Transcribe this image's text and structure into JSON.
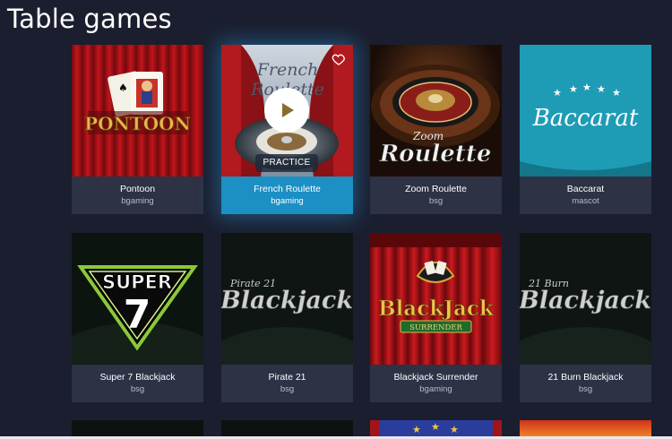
{
  "page": {
    "title": "Table games"
  },
  "games": [
    {
      "name": "Pontoon",
      "provider": "bgaming",
      "logo_text": "PONTOON"
    },
    {
      "name": "French Roulette",
      "provider": "bgaming",
      "logo_text_1": "French",
      "logo_text_2": "Roulette",
      "practice_label": "PRACTICE"
    },
    {
      "name": "Zoom Roulette",
      "provider": "bsg",
      "logo_text_1": "Zoom",
      "logo_text_2": "Roulette"
    },
    {
      "name": "Baccarat",
      "provider": "mascot",
      "logo_text": "Baccarat"
    },
    {
      "name": "Super 7 Blackjack",
      "provider": "bsg",
      "logo_text_1": "SUPER",
      "logo_text_2": "7"
    },
    {
      "name": "Pirate 21",
      "provider": "bsg",
      "logo_text_1": "Pirate 21",
      "logo_text_2": "Blackjack"
    },
    {
      "name": "Blackjack Surrender",
      "provider": "bgaming",
      "logo_text_1": "BlackJack",
      "logo_text_2": "SURRENDER"
    },
    {
      "name": "21 Burn Blackjack",
      "provider": "bsg",
      "logo_text_1": "21 Burn",
      "logo_text_2": "Blackjack"
    }
  ],
  "colors": {
    "background": "#1b1e2e",
    "card_info": "#2d3245",
    "active_info": "#1c8fc4",
    "baccarat_teal": "#1e9cb6",
    "curtain_red": "#b5141a",
    "gold": "#e6b84a"
  }
}
